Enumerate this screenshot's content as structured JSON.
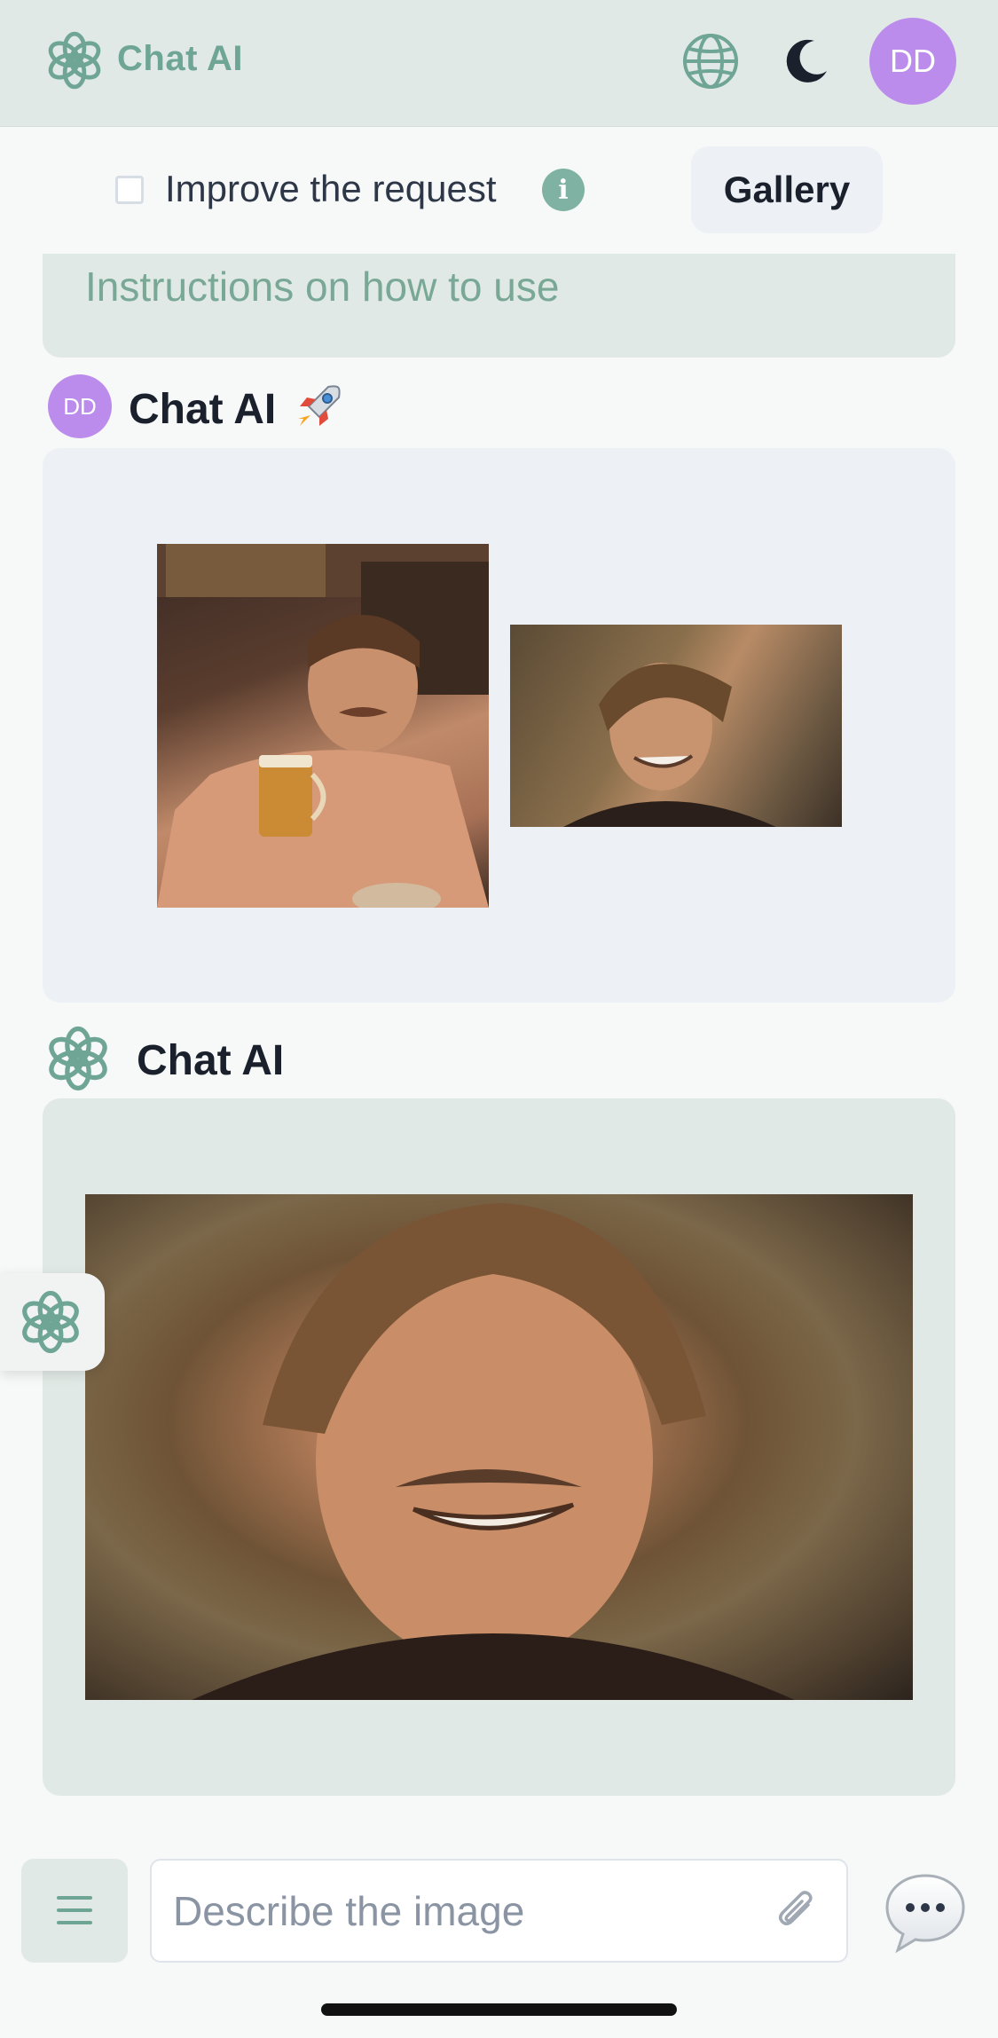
{
  "header": {
    "brand": "Chat AI",
    "avatar_initials": "DD"
  },
  "toolbar": {
    "improve_label": "Improve the request",
    "info_symbol": "i",
    "gallery_label": "Gallery"
  },
  "instructions": {
    "text": "Instructions on how to use"
  },
  "user_message": {
    "avatar_initials": "DD",
    "name": "Chat AI",
    "images": [
      "photo-man-with-beer",
      "photo-smiling-man"
    ]
  },
  "ai_message": {
    "name": "Chat AI",
    "images": [
      "photo-generated-face-swap"
    ]
  },
  "composer": {
    "placeholder": "Describe the image"
  },
  "colors": {
    "accent": "#6fa595",
    "header_bg": "#e1e9e6",
    "avatar_bg": "#bc8cec",
    "card_bg": "#edf1f5"
  },
  "icons": [
    "logo-icon",
    "globe-icon",
    "moon-icon",
    "info-icon",
    "rocket-icon",
    "menu-icon",
    "paperclip-icon",
    "chat-bubble-icon"
  ]
}
